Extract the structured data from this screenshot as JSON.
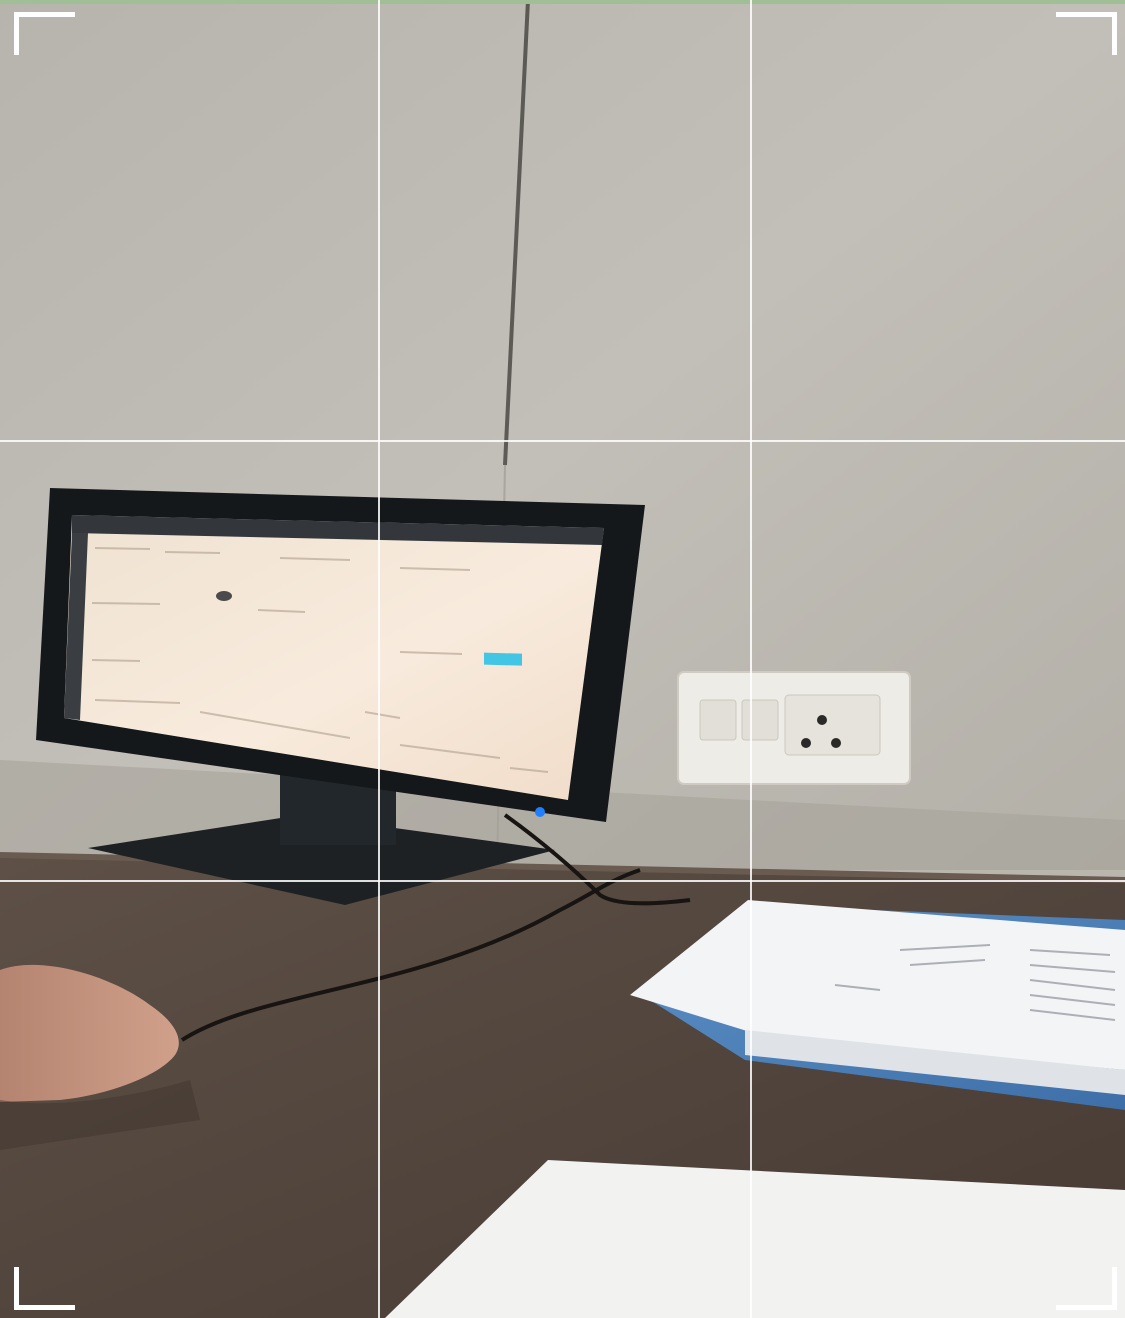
{
  "crop_overlay": {
    "grid_lines": "rule-of-thirds",
    "grid_color": "#ffffff",
    "corner_handles": [
      "top-left",
      "top-right",
      "bottom-left",
      "bottom-right"
    ],
    "handle_color": "#ffffff"
  },
  "scene": {
    "wall_color": "#bcb9b1",
    "desk_color": "#5b4d43",
    "monitor_screen_color": "#f3e4d3",
    "monitor_button_color": "#1f7fff",
    "screen_ui_accent": "#43c5e4"
  },
  "icons": [
    "crop-corner-icon"
  ]
}
